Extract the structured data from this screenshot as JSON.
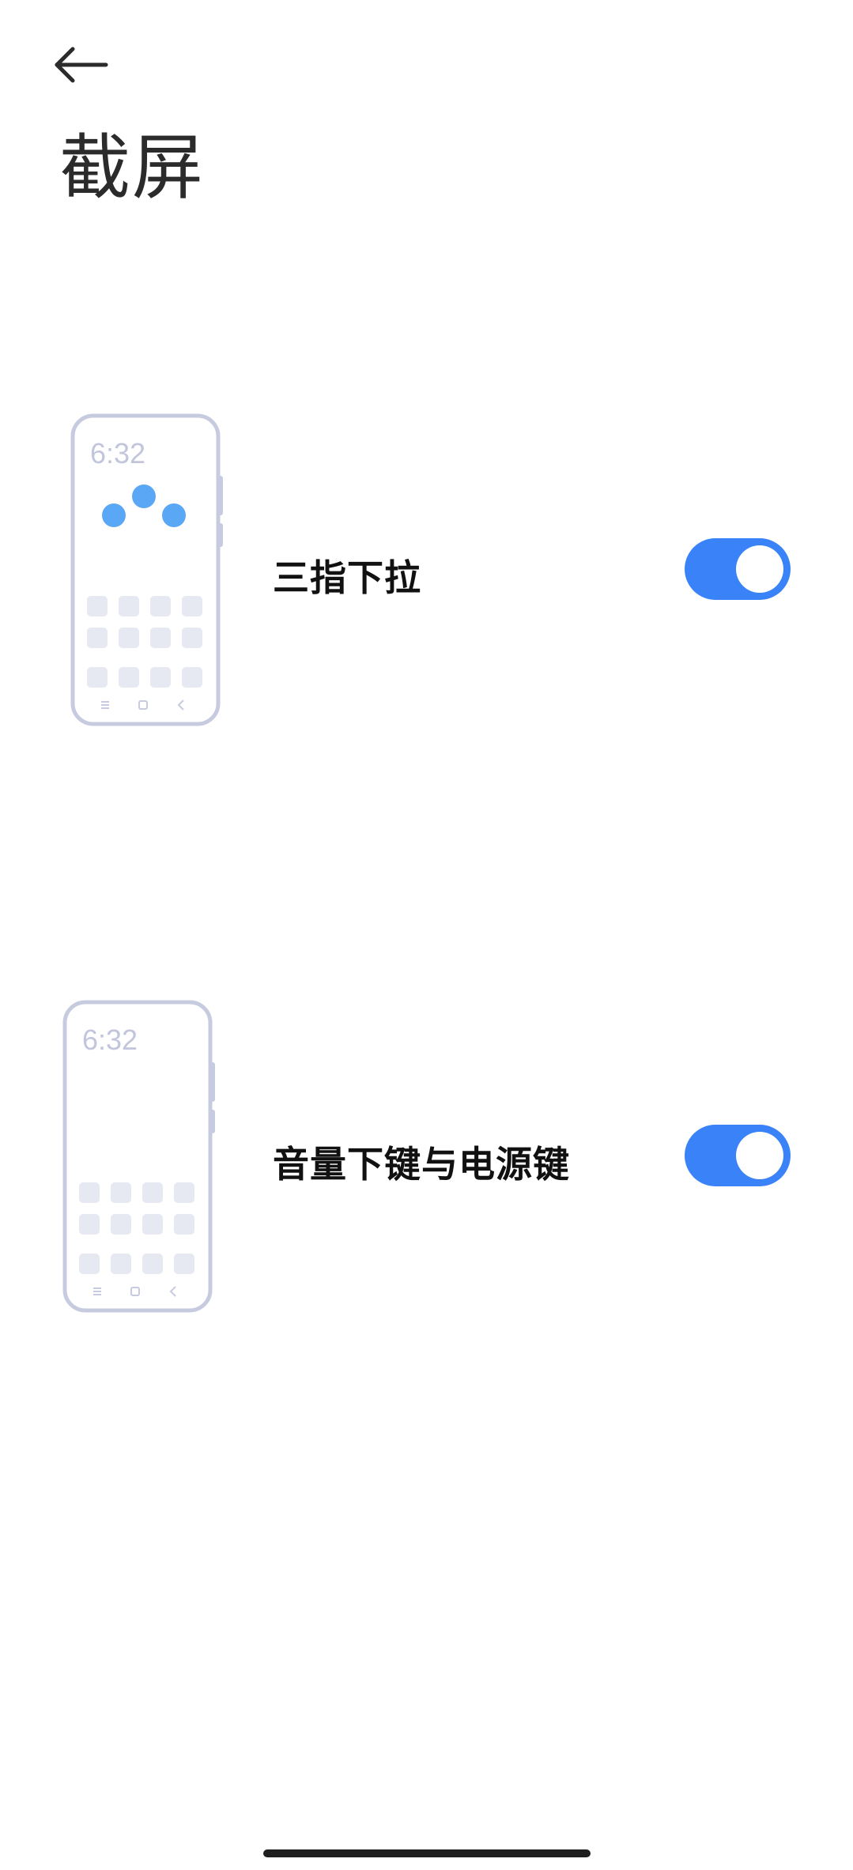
{
  "header": {
    "title": "截屏",
    "back_icon": "back-arrow-icon"
  },
  "settings": [
    {
      "label": "三指下拉",
      "enabled": true,
      "illustration": {
        "clock": "6:32",
        "gesture": "three-finger-dots"
      }
    },
    {
      "label": "音量下键与电源键",
      "enabled": true,
      "illustration": {
        "clock": "6:32",
        "gesture": "side-buttons"
      }
    }
  ],
  "colors": {
    "accent": "#3a82f7",
    "dots": "#5aa7f5",
    "phone_outline": "#c7cbe0",
    "app_tile": "#e7e9f2",
    "clock": "#c2c6dc"
  }
}
